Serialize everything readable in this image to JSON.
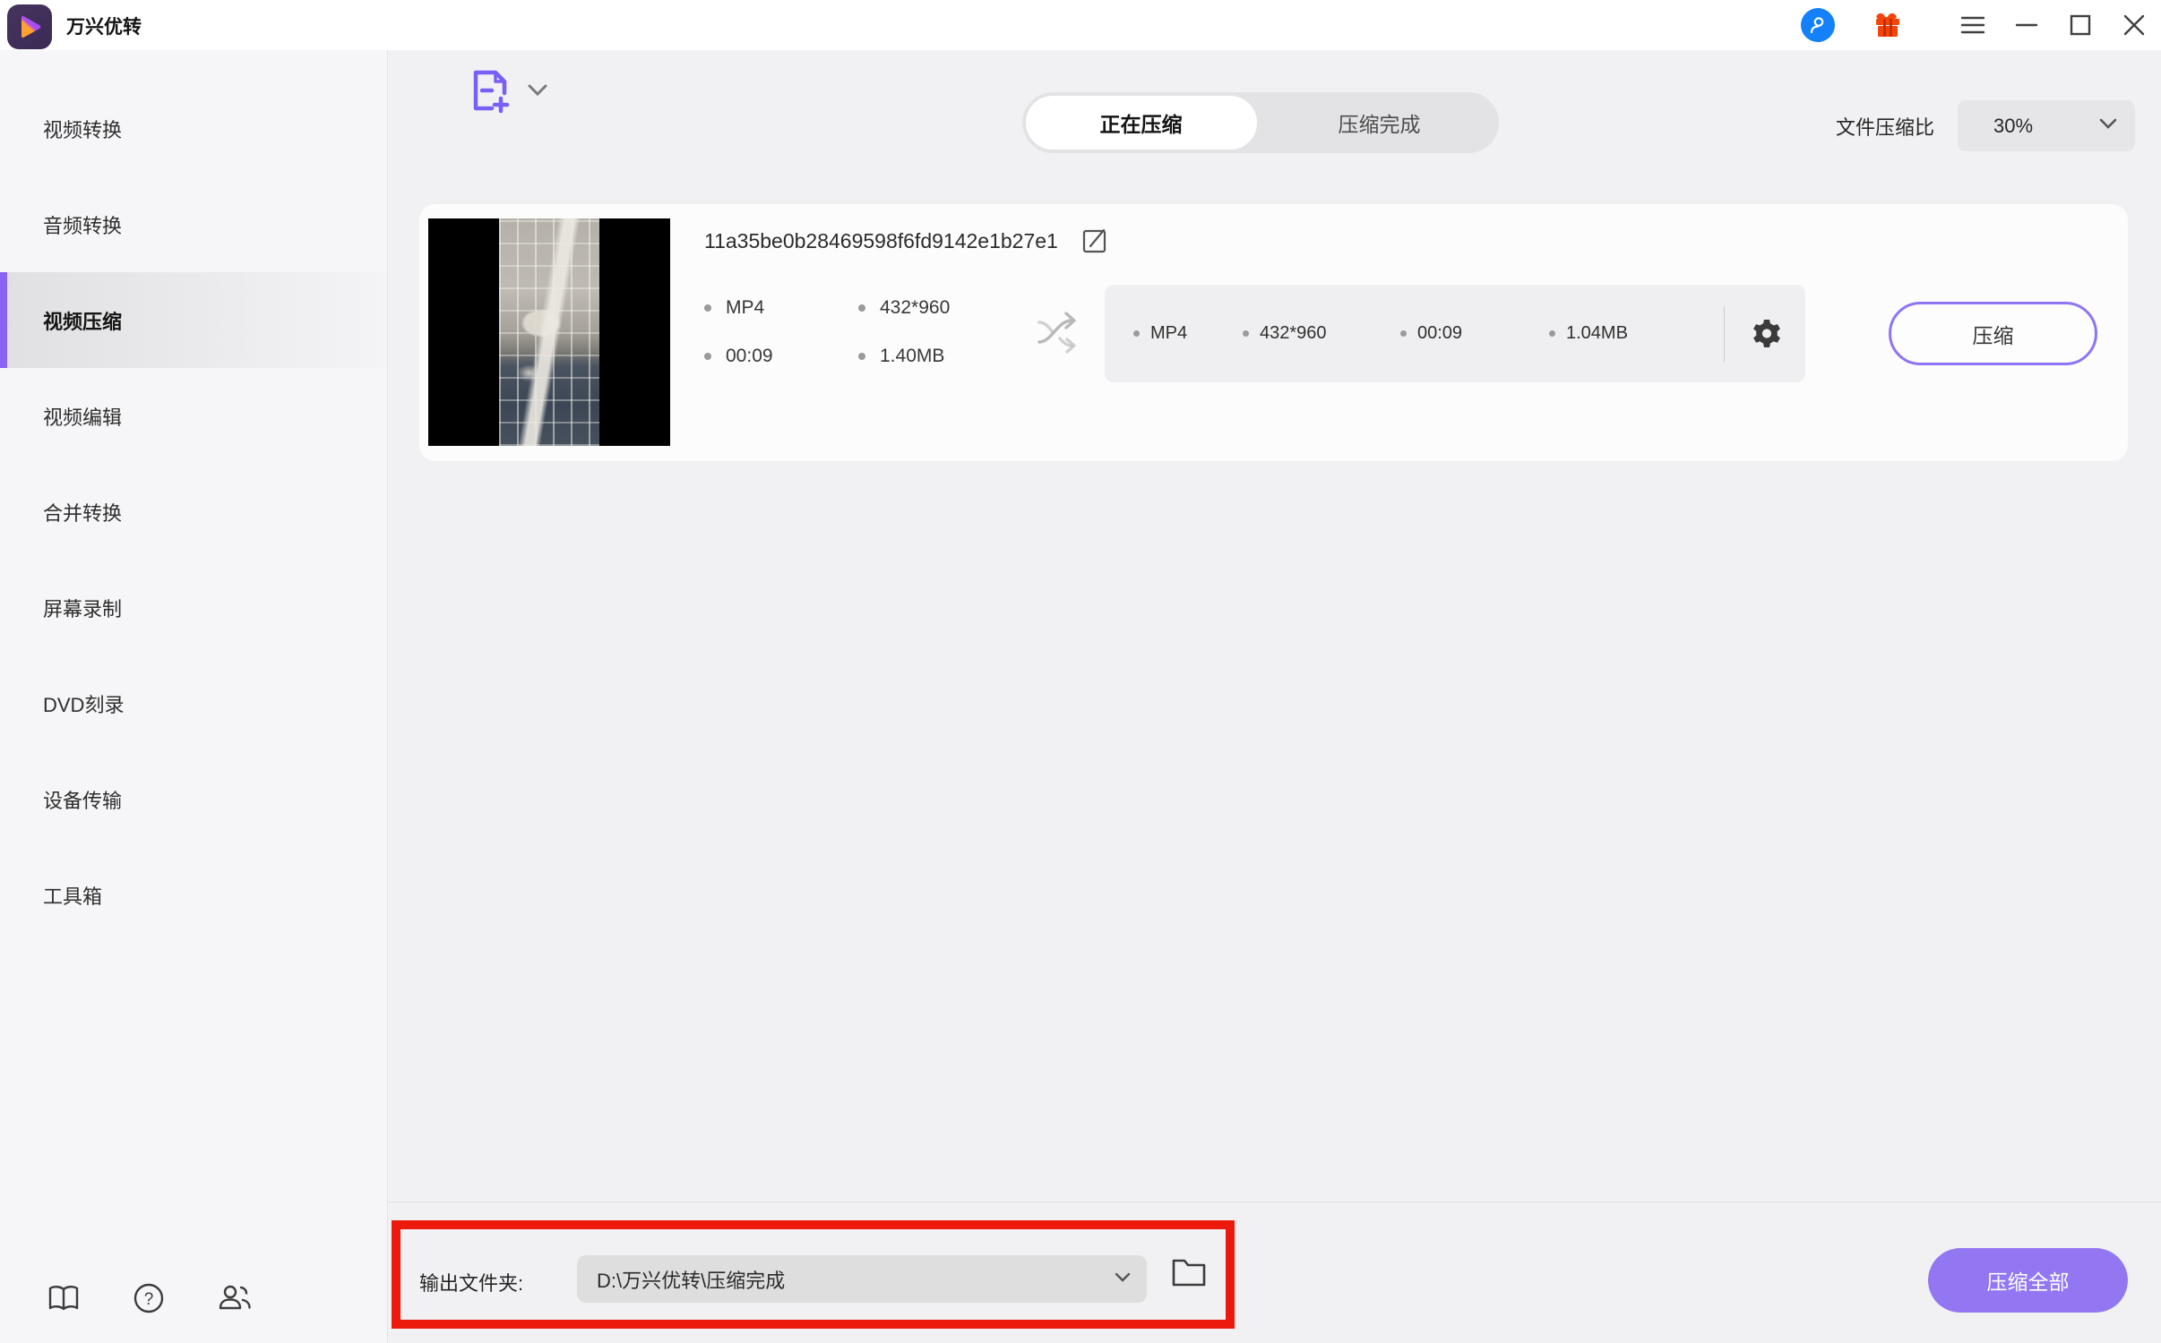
{
  "titlebar": {
    "app_title": "万兴优转",
    "icons": [
      "account-icon",
      "gift-icon",
      "menu-icon",
      "minimize-icon",
      "maximize-icon",
      "close-icon"
    ]
  },
  "sidebar": {
    "items": [
      {
        "label": "视频转换"
      },
      {
        "label": "音频转换"
      },
      {
        "label": "视频压缩"
      },
      {
        "label": "视频编辑"
      },
      {
        "label": "合并转换"
      },
      {
        "label": "屏幕录制"
      },
      {
        "label": "DVD刻录"
      },
      {
        "label": "设备传输"
      },
      {
        "label": "工具箱"
      }
    ],
    "active_index": 2,
    "bottom_icons": [
      "book-icon",
      "help-icon",
      "users-icon"
    ]
  },
  "toolbar": {
    "add_file_icon": "add-file-icon",
    "tabs": [
      {
        "label": "正在压缩",
        "active": true
      },
      {
        "label": "压缩完成",
        "active": false
      }
    ],
    "ratio_label": "文件压缩比",
    "ratio_value": "30%"
  },
  "file": {
    "name": "11a35be0b28469598f6fd9142e1b27e1",
    "source": {
      "format": "MP4",
      "resolution": "432*960",
      "duration": "00:09",
      "size": "1.40MB"
    },
    "target": {
      "format": "MP4",
      "resolution": "432*960",
      "duration": "00:09",
      "size": "1.04MB"
    },
    "compress_label": "压缩"
  },
  "footer": {
    "output_label": "输出文件夹:",
    "output_path": "D:\\万兴优转\\压缩完成",
    "compress_all_label": "压缩全部"
  },
  "colors": {
    "accent_purple": "#8a63f2",
    "button_purple": "#9377f2",
    "annotation_red": "#ec1a0c",
    "avatar_blue": "#1480fa",
    "gift_orange": "#f44a0a"
  }
}
